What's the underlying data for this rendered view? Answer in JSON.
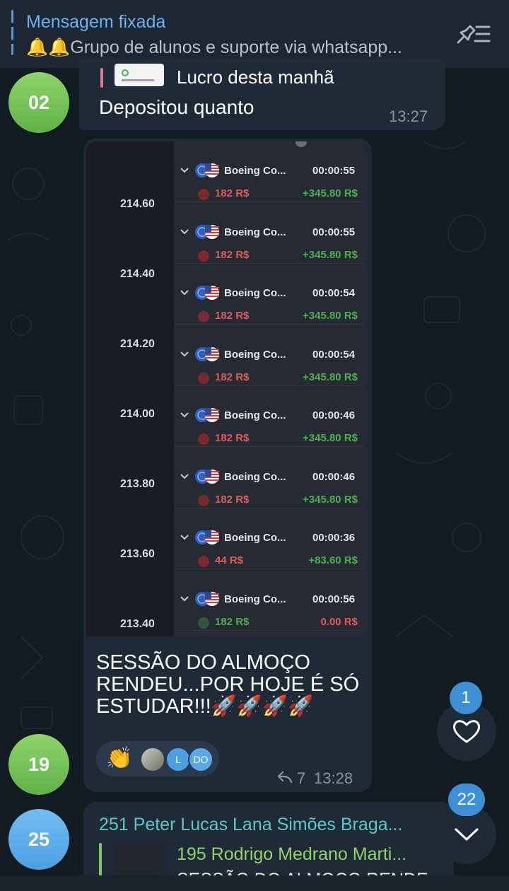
{
  "pinned": {
    "title": "Mensagem fixada",
    "text": "🔔🔔Grupo de alunos e suporte via whatsapp..."
  },
  "messages": [
    {
      "avatar_label": "02",
      "avatar_color": "#6fc24f",
      "reply_text": "Lucro desta manhã",
      "text": "Depositou quanto",
      "time": "13:27"
    },
    {
      "avatar_label": "19",
      "avatar_color": "#6fc24f",
      "screenshot": {
        "prices": [
          "214.60",
          "214.40",
          "214.20",
          "214.00",
          "213.80",
          "213.60",
          "213.40"
        ],
        "trades": [
          {
            "asset": "Boeing Co...",
            "duration": "00:00:55",
            "amount": "182 R$",
            "profit": "+345.80 R$",
            "win": true
          },
          {
            "asset": "Boeing Co...",
            "duration": "00:00:55",
            "amount": "182 R$",
            "profit": "+345.80 R$",
            "win": true
          },
          {
            "asset": "Boeing Co...",
            "duration": "00:00:54",
            "amount": "182 R$",
            "profit": "+345.80 R$",
            "win": true
          },
          {
            "asset": "Boeing Co...",
            "duration": "00:00:54",
            "amount": "182 R$",
            "profit": "+345.80 R$",
            "win": true
          },
          {
            "asset": "Boeing Co...",
            "duration": "00:00:46",
            "amount": "182 R$",
            "profit": "+345.80 R$",
            "win": true
          },
          {
            "asset": "Boeing Co...",
            "duration": "00:00:46",
            "amount": "182 R$",
            "profit": "+345.80 R$",
            "win": true
          },
          {
            "asset": "Boeing Co...",
            "duration": "00:00:36",
            "amount": "44 R$",
            "profit": "+83.60 R$",
            "win": true
          },
          {
            "asset": "Boeing Co...",
            "duration": "00:00:56",
            "amount": "182 R$",
            "profit": "0.00 R$",
            "win": false
          }
        ]
      },
      "caption": "SESSÃO DO ALMOÇO RENDEU...POR HOJE É SÓ ESTUDAR!!!🚀🚀🚀🚀",
      "reactions": {
        "emoji": "👏",
        "avatar_2": "L",
        "avatar_3": "DO"
      },
      "forwards": "7",
      "time": "13:28"
    },
    {
      "avatar_label": "25",
      "avatar_color": "#4c9fe0",
      "sender": "251 Peter Lucas Lana Simões Braga...",
      "quote_sender": "195 Rodrigo Medrano Marti...",
      "quote_text": "SESSÃO DO ALMOÇO RENDE..."
    }
  ],
  "floating": {
    "reaction_badge": "1",
    "unread_badge": "22"
  },
  "colors": {
    "accent": "#6ab2f2",
    "bubble": "#1e2b36",
    "win": "#4caf50",
    "loss": "#e05a5a"
  }
}
